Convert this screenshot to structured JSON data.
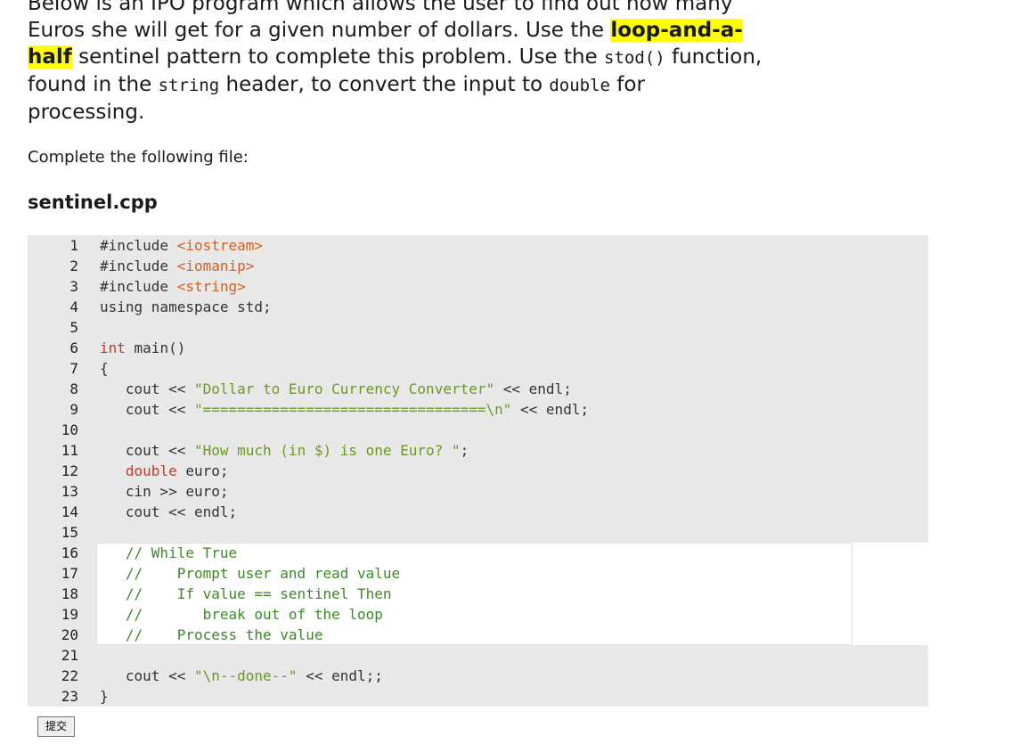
{
  "intro": {
    "p1": "Below is an IPO program which allows the user to find out how many Euros she will get for a given number of dollars. Use the ",
    "highlight": "loop-and-a-half",
    "p2": " sentinel pattern to complete this problem. Use the ",
    "code1": "stod()",
    "p3": " function, found in the ",
    "code2": "string",
    "p4": " header, to convert the input to ",
    "code3": "double",
    "p5": " for processing."
  },
  "subtitle": "Complete the following file:",
  "filename": "sentinel.cpp",
  "code": {
    "line_numbers": [
      "1",
      "2",
      "3",
      "4",
      "5",
      "6",
      "7",
      "8",
      "9",
      "10",
      "11",
      "12",
      "13",
      "14",
      "15",
      "16",
      "17",
      "18",
      "19",
      "20",
      "21",
      "22",
      "23"
    ],
    "l1a": "#include ",
    "l1b": "<iostream>",
    "l2a": "#include ",
    "l2b": "<iomanip>",
    "l3a": "#include ",
    "l3b": "<string>",
    "l4": "using namespace std;",
    "l6a": "int",
    "l6b": " main()",
    "l7": "{",
    "l8a": "   cout << ",
    "l8b": "\"Dollar to Euro Currency Converter\"",
    "l8c": " << endl;",
    "l9a": "   cout << ",
    "l9b": "\"=================================\\n\"",
    "l9c": " << endl;",
    "l11a": "   cout << ",
    "l11b": "\"How much (in $) is one Euro? \"",
    "l11c": ";",
    "l12a": "   ",
    "l12b": "double",
    "l12c": " euro;",
    "l13": "   cin >> euro;",
    "l14": "   cout << endl;",
    "l16": "   // While True",
    "l17": "   //    Prompt user and read value",
    "l18": "   //    If value == sentinel Then",
    "l19": "   //       break out of the loop",
    "l20": "   //    Process the value",
    "l22a": "   cout << ",
    "l22b": "\"\\n--done--\"",
    "l22c": " << endl;;",
    "l23": "}"
  },
  "submit_label": "提交",
  "colors": {
    "highlight": "#ffff00",
    "editor_bg": "#e8e8e8",
    "keyword": "#c0392b",
    "string": "#6a9a1f",
    "include": "#d35f1f",
    "comment": "#3b8a24"
  }
}
